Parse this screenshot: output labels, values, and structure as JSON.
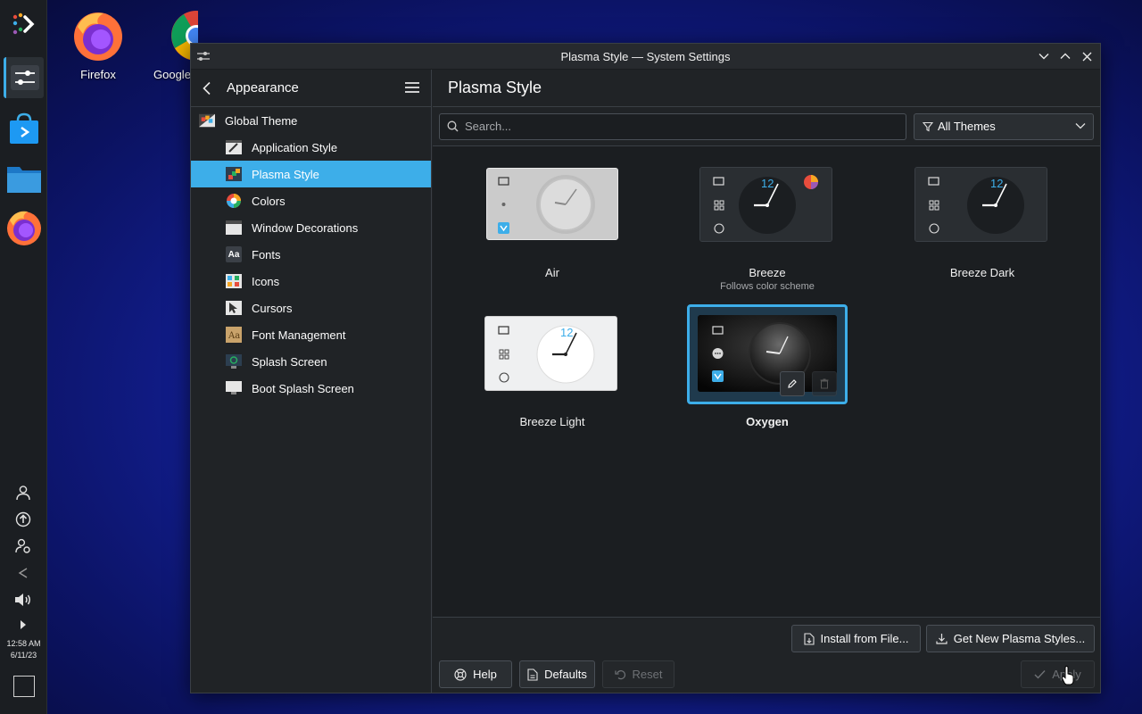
{
  "desktop": {
    "icons": [
      {
        "label": "Firefox"
      },
      {
        "label": "Google"
      }
    ]
  },
  "panel": {
    "time": "12:58 AM",
    "date": "6/11/23"
  },
  "window": {
    "title": "Plasma Style — System Settings"
  },
  "sidebar": {
    "title": "Appearance",
    "items": [
      {
        "label": "Global Theme",
        "icon": "global-theme-icon"
      },
      {
        "label": "Application Style",
        "icon": "application-style-icon"
      },
      {
        "label": "Plasma Style",
        "icon": "plasma-style-icon"
      },
      {
        "label": "Colors",
        "icon": "colors-icon"
      },
      {
        "label": "Window Decorations",
        "icon": "window-decorations-icon"
      },
      {
        "label": "Fonts",
        "icon": "fonts-icon"
      },
      {
        "label": "Icons",
        "icon": "icons-icon"
      },
      {
        "label": "Cursors",
        "icon": "cursors-icon"
      },
      {
        "label": "Font Management",
        "icon": "font-management-icon"
      },
      {
        "label": "Splash Screen",
        "icon": "splash-screen-icon"
      },
      {
        "label": "Boot Splash Screen",
        "icon": "boot-splash-screen-icon"
      }
    ],
    "fonts_icon_text": "Aa"
  },
  "content": {
    "title": "Plasma Style",
    "search_placeholder": "Search...",
    "filter_value": "All Themes",
    "themes": [
      {
        "name": "Air",
        "subtitle": ""
      },
      {
        "name": "Breeze",
        "subtitle": "Follows color scheme"
      },
      {
        "name": "Breeze Dark",
        "subtitle": ""
      },
      {
        "name": "Breeze Light",
        "subtitle": ""
      },
      {
        "name": "Oxygen",
        "subtitle": "",
        "selected": true
      }
    ],
    "clock_number": "12"
  },
  "footer": {
    "install_label": "Install from File...",
    "get_new_label": "Get New Plasma Styles...",
    "help_label": "Help",
    "defaults_label": "Defaults",
    "reset_label": "Reset",
    "apply_label": "Apply"
  },
  "colors": {
    "accent": "#3daee9",
    "window_bg": "#202326",
    "view_bg": "#1b1e21"
  }
}
